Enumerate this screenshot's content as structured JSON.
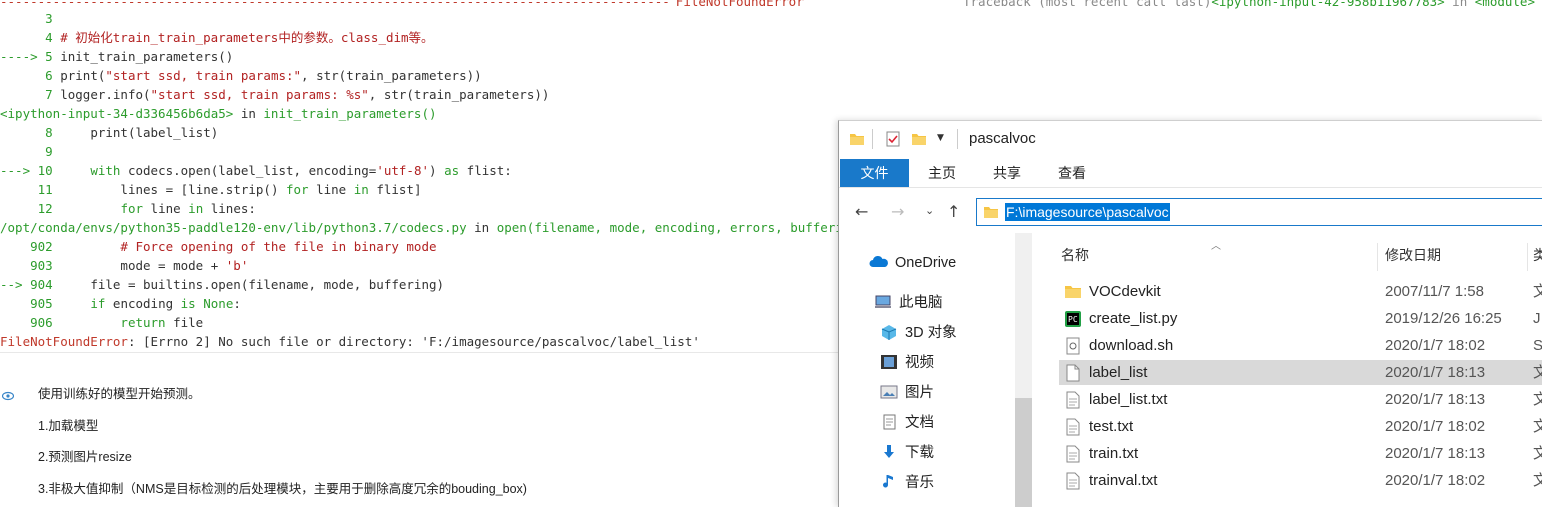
{
  "notebook": {
    "top_banner": {
      "dashes": "-----------------------------------------------------------------------------------------",
      "error_name": "FileNotFoundError",
      "traceback": "Traceback (most recent call last)",
      "traceback_loc": "<ipython-input-42-958b11967783>",
      "traceback_in": " in ",
      "traceback_mod": "<module>"
    },
    "code_lines": [
      {
        "prefix": "      ",
        "num": "3",
        "code": ""
      },
      {
        "prefix": "      ",
        "num": "4",
        "code": " # 初始化train_train_parameters中的参数。class_dim等。",
        "style": "cmt"
      },
      {
        "prefix": "----> ",
        "num": "5",
        "code": " init_train_parameters()",
        "arrow": true
      },
      {
        "prefix": "      ",
        "num": "6",
        "code": " print(\"start ssd, train params:\", str(train_parameters))"
      },
      {
        "prefix": "      ",
        "num": "7",
        "code": " logger.info(\"start ssd, train params: %s\", str(train_parameters))"
      },
      {
        "loc_line": true,
        "loc": "<ipython-input-34-d336456b6da5>",
        "in": " in ",
        "fn": "init_train_parameters()"
      },
      {
        "prefix": "      ",
        "num": "8",
        "code": "     print(label_list)"
      },
      {
        "prefix": "      ",
        "num": "9",
        "code": ""
      },
      {
        "prefix": "---> ",
        "num": "10",
        "code": "     with codecs.open(label_list, encoding='utf-8') as flist:",
        "arrow": true
      },
      {
        "prefix": "     ",
        "num": "11",
        "code": "         lines = [line.strip() for line in flist]"
      },
      {
        "prefix": "     ",
        "num": "12",
        "code": "         for line in lines:"
      },
      {
        "loc_line": true,
        "loc": "/opt/conda/envs/python35-paddle120-env/lib/python3.7/codecs.py",
        "in": " in ",
        "fn": "open(filename, mode, encoding, errors, buffering)"
      },
      {
        "prefix": "    ",
        "num": "902",
        "code": "         # Force opening of the file in binary mode",
        "style": "cmt"
      },
      {
        "prefix": "    ",
        "num": "903",
        "code": "         mode = mode + 'b'"
      },
      {
        "prefix": "--> ",
        "num": "904",
        "code": "     file = builtins.open(filename, mode, buffering)",
        "arrow": true
      },
      {
        "prefix": "    ",
        "num": "905",
        "code": "     if encoding is None:"
      },
      {
        "prefix": "    ",
        "num": "906",
        "code": "         return file"
      },
      {
        "error_line": true,
        "text": "FileNotFoundError",
        "rest": ": [Errno 2] No such file or directory: 'F:/imagesource/pascalvoc/label_list'"
      }
    ],
    "markdown": [
      "使用训练好的模型开始预测。",
      "1.加载模型",
      "2.预测图片resize",
      "3.非极大值抑制（NMS是目标检测的后处理模块，主要用于删除高度冗余的bouding_box)"
    ]
  },
  "explorer": {
    "title": "pascalvoc",
    "ribbon_tabs": [
      "文件",
      "主页",
      "共享",
      "查看"
    ],
    "address": "F:\\imagesource\\pascalvoc",
    "nav_items": [
      {
        "label": "OneDrive",
        "icon": "cloud-icon"
      },
      {
        "label": "此电脑",
        "icon": "computer-icon"
      },
      {
        "label": "3D 对象",
        "icon": "cube-icon"
      },
      {
        "label": "视频",
        "icon": "video-icon"
      },
      {
        "label": "图片",
        "icon": "picture-icon"
      },
      {
        "label": "文档",
        "icon": "document-icon"
      },
      {
        "label": "下载",
        "icon": "download-icon"
      },
      {
        "label": "音乐",
        "icon": "music-icon"
      }
    ],
    "columns": {
      "name": "名称",
      "date": "修改日期",
      "type": "类"
    },
    "files": [
      {
        "name": "VOCdevkit",
        "date": "2007/11/7 1:58",
        "extra": "文",
        "icon": "folder-icon"
      },
      {
        "name": "create_list.py",
        "date": "2019/12/26 16:25",
        "extra": "J",
        "icon": "python-file-icon"
      },
      {
        "name": "download.sh",
        "date": "2020/1/7 18:02",
        "extra": "S",
        "icon": "script-file-icon"
      },
      {
        "name": "label_list",
        "date": "2020/1/7 18:13",
        "extra": "文",
        "icon": "file-icon",
        "selected": true
      },
      {
        "name": "label_list.txt",
        "date": "2020/1/7 18:13",
        "extra": "文",
        "icon": "text-file-icon"
      },
      {
        "name": "test.txt",
        "date": "2020/1/7 18:02",
        "extra": "文",
        "icon": "text-file-icon"
      },
      {
        "name": "train.txt",
        "date": "2020/1/7 18:13",
        "extra": "文",
        "icon": "text-file-icon"
      },
      {
        "name": "trainval.txt",
        "date": "2020/1/7 18:02",
        "extra": "文",
        "icon": "text-file-icon"
      }
    ],
    "colors": {
      "accent": "#1979ca",
      "selection": "#0078d7",
      "row_selected": "#d9d9d9",
      "folder": "#f6c544"
    }
  }
}
